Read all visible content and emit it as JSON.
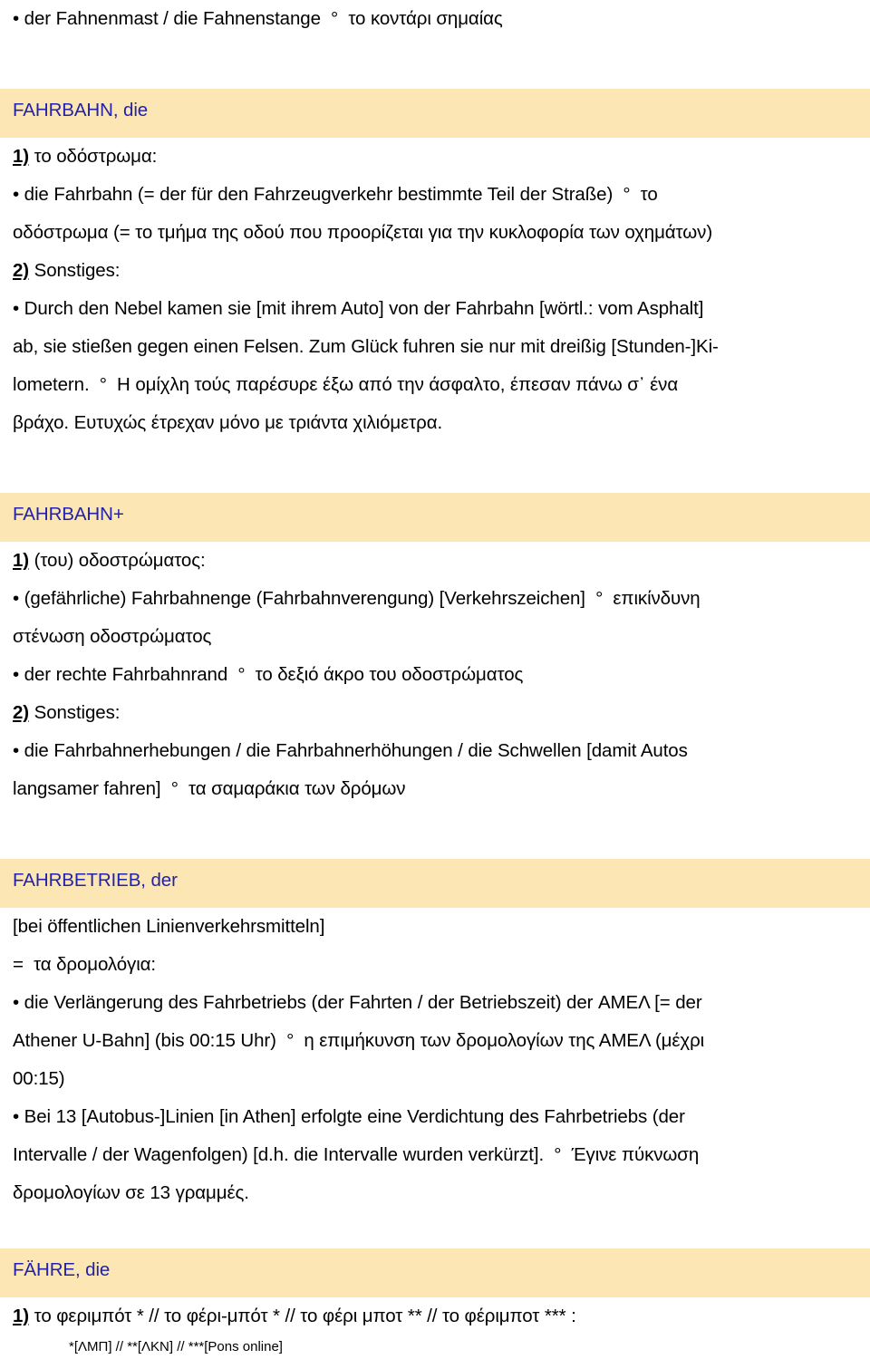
{
  "document": {
    "type": "bilingual-dictionary-page",
    "languages": "German-Greek",
    "colors": {
      "headword_text": "#2222aa",
      "headword_band": "#fbe6b4",
      "body_text": "#000000",
      "page_background": "#ffffff"
    }
  },
  "top_entry_tail": {
    "line1": "• der Fahnenmast / die Fahnenstange  °  το κοντάρι σημαίας"
  },
  "entries": [
    {
      "id": "fahrbahn",
      "headword": "FAHRBAHN, die",
      "senses": [
        {
          "marker": "1)",
          "label": " το οδόστρωμα:",
          "lines": [
            "• die Fahrbahn (= der für den Fahrzeugverkehr bestimmte Teil der Straße)  °  το",
            "οδόστρωμα (= το τμήμα της οδού που προορίζεται για την κυκλοφορία των οχημάτων)"
          ]
        },
        {
          "marker": "2)",
          "label": " Sonstiges:",
          "lines": [
            "• Durch den Nebel kamen sie [mit ihrem Auto] von der Fahrbahn [wörtl.: vom Asphalt]",
            "ab, sie stießen gegen einen Felsen. Zum Glück fuhren sie nur mit dreißig [Stunden-]Ki-",
            "lometern.  °  Η ομίχλη τούς παρέσυρε έξω από την άσφαλτο, έπεσαν πάνω σ᾽ ένα",
            "βράχο. Ευτυχώς έτρεχαν μόνο με τριάντα χιλιόμετρα."
          ]
        }
      ]
    },
    {
      "id": "fahrbahn-plus",
      "headword": "FAHRBAHN+",
      "senses": [
        {
          "marker": "1)",
          "label": " (του) οδοστρώματος:",
          "lines": [
            "• (gefährliche) Fahrbahnenge (Fahrbahnverengung) [Verkehrszeichen]  °  επικίνδυνη",
            "στένωση οδοστρώματος",
            "• der rechte Fahrbahnrand  °  το δεξιό άκρο του οδοστρώματος"
          ]
        },
        {
          "marker": "2)",
          "label": " Sonstiges:",
          "lines": [
            "• die Fahrbahnerhebungen / die Fahrbahnerhöhungen / die Schwellen [damit Autos",
            "langsamer fahren]  °  τα σαμαράκια των δρόμων"
          ]
        }
      ]
    },
    {
      "id": "fahrbetrieb",
      "headword": "FAHRBETRIEB, der",
      "preamble": [
        "[bei öffentlichen Linienverkehrsmitteln]",
        "=  τα δρομολόγια:"
      ],
      "lines": [
        "• die Verlängerung des Fahrbetriebs (der Fahrten / der Betriebszeit) der ΑΜΕΛ [= der",
        "Athener U-Bahn] (bis 00:15 Uhr)  °  η επιμήκυνση των δρομολογίων της ΑΜΕΛ (μέχρι",
        "00:15)",
        "• Bei 13 [Autobus-]Linien [in Athen] erfolgte eine Verdichtung des Fahrbetriebs (der",
        "Intervalle / der Wagenfolgen) [d.h. die Intervalle wurden verkürzt].  °  Έγινε πύκνωση",
        "δρομολογίων σε 13 γραμμές."
      ]
    },
    {
      "id": "faehre",
      "headword": "FÄHRE, die",
      "senses": [
        {
          "marker": "1)",
          "label": " το φεριμπότ * // το φέρι-μπότ * // το φέρι μποτ ** // το φέριμποτ *** :",
          "lines": []
        }
      ],
      "footnote": "*[ΛΜΠ] // **[ΛΚΝ] // ***[Pons online]"
    }
  ]
}
